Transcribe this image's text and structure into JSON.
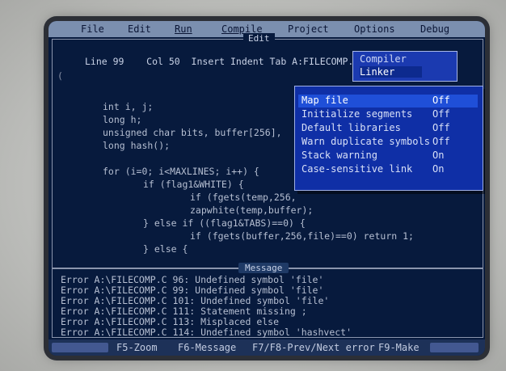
{
  "menubar": {
    "items": [
      "File",
      "Edit",
      "Run",
      "Compile",
      "Project",
      "Options",
      "Debug"
    ]
  },
  "editor": {
    "title": "Edit",
    "status": "Line 99    Col 50  Insert Indent Tab A:FILECOMP.C",
    "marker": "(",
    "code": [
      "int i, j;",
      "long h;",
      "unsigned char bits, buffer[256],",
      "long hash();",
      "for (i=0; i<MAXLINES; i++) {",
      "if (flag1&WHITE) {",
      "if (fgets(temp,256,",
      "zapwhite(temp,buffer);",
      "} else if ((flag1&TABS)==0) {",
      "if (fgets(buffer,256,file)==0) return 1;",
      "} else {"
    ]
  },
  "compile_menu": {
    "items": [
      "Compiler",
      "Linker"
    ]
  },
  "linker_menu": {
    "items": [
      {
        "label": "Map file",
        "value": "Off"
      },
      {
        "label": "Initialize segments",
        "value": "Off"
      },
      {
        "label": "Default libraries",
        "value": "Off"
      },
      {
        "label": "Warn duplicate symbols",
        "value": "Off"
      },
      {
        "label": "Stack warning",
        "value": "On"
      },
      {
        "label": "Case-sensitive link",
        "value": "On"
      }
    ]
  },
  "messages": {
    "title": "Message",
    "lines": [
      "Error A:\\FILECOMP.C 96: Undefined symbol 'file'",
      "Error A:\\FILECOMP.C 99: Undefined symbol 'file'",
      "Error A:\\FILECOMP.C 101: Undefined symbol 'file'",
      "Error A:\\FILECOMP.C 111: Statement missing ;",
      "Error A:\\FILECOMP.C 113: Misplaced else",
      "Error A:\\FILECOMP.C 114: Undefined symbol 'hashvect'"
    ]
  },
  "fkeys": {
    "zoom": "F5-Zoom",
    "message": "F6-Message",
    "error": "F7/F8-Prev/Next error",
    "make": "F9-Make"
  },
  "colors": {
    "screen_bg": "#071a3d",
    "menubar_bg": "#7b8faf",
    "menu_bg": "#1b3ab0",
    "menu_highlight": "#1f4fd8"
  }
}
